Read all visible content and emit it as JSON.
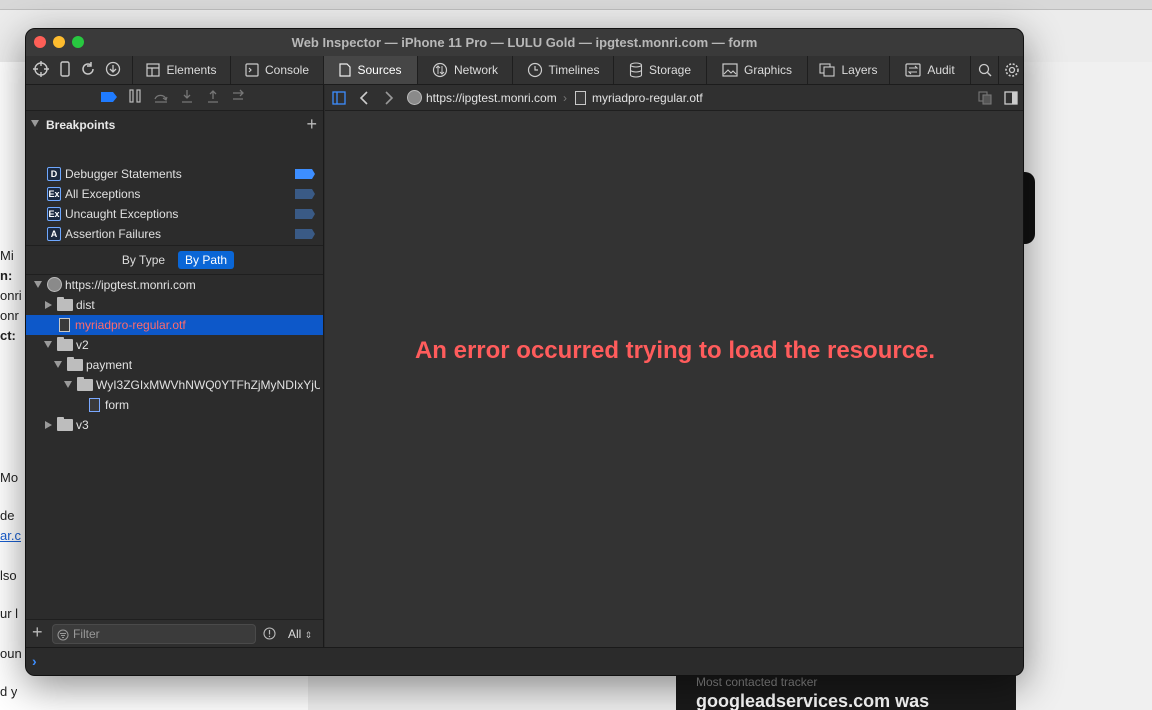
{
  "window": {
    "title": "Web Inspector — iPhone 11 Pro — LULU Gold — ipgtest.monri.com — form"
  },
  "tabs": [
    {
      "label": "Elements"
    },
    {
      "label": "Console"
    },
    {
      "label": "Sources"
    },
    {
      "label": "Network"
    },
    {
      "label": "Timelines"
    },
    {
      "label": "Storage"
    },
    {
      "label": "Graphics"
    },
    {
      "label": "Layers"
    },
    {
      "label": "Audit"
    }
  ],
  "active_tab": "Sources",
  "breakpoints": {
    "title": "Breakpoints",
    "items": [
      {
        "badge": "D",
        "label": "Debugger Statements",
        "active": true
      },
      {
        "badge": "Ex",
        "label": "All Exceptions",
        "active": false
      },
      {
        "badge": "Ex",
        "label": "Uncaught Exceptions",
        "active": false
      },
      {
        "badge": "A",
        "label": "Assertion Failures",
        "active": false
      }
    ]
  },
  "grouping": {
    "by_type": "By Type",
    "by_path": "By Path",
    "selected": "By Path"
  },
  "tree": {
    "root": "https://ipgtest.monri.com",
    "dist": "dist",
    "font_file": "myriadpro-regular.otf",
    "v2": "v2",
    "payment": "payment",
    "payment_token": "WyI3ZGIxMWVhNWQ0YTFhZjMyNDIxYjU...",
    "form": "form",
    "v3": "v3"
  },
  "filter": {
    "placeholder": "Filter",
    "scope": "All"
  },
  "navbar": {
    "host": "https://ipgtest.monri.com",
    "file": "myriadpro-regular.otf"
  },
  "content": {
    "error": "An error occurred trying to load the resource."
  },
  "background": {
    "frag_1": "Mi",
    "frag_2": "n:",
    "frag_3": "onri",
    "frag_4": "onr",
    "frag_5": "ct:",
    "frag_6": "Mo",
    "frag_7": "de",
    "frag_8": "ar.c",
    "frag_9": "lso",
    "frag_10": "ur l",
    "frag_11": "oun",
    "frag_12": "d y",
    "tracker_caption": "Most contacted tracker",
    "tracker_text": "googleadservices.com was"
  },
  "colors": {
    "accent": "#0a66d6",
    "error": "#ff5c5c",
    "flag_active": "#3d8eff",
    "flag_inactive": "#3a5a85"
  }
}
